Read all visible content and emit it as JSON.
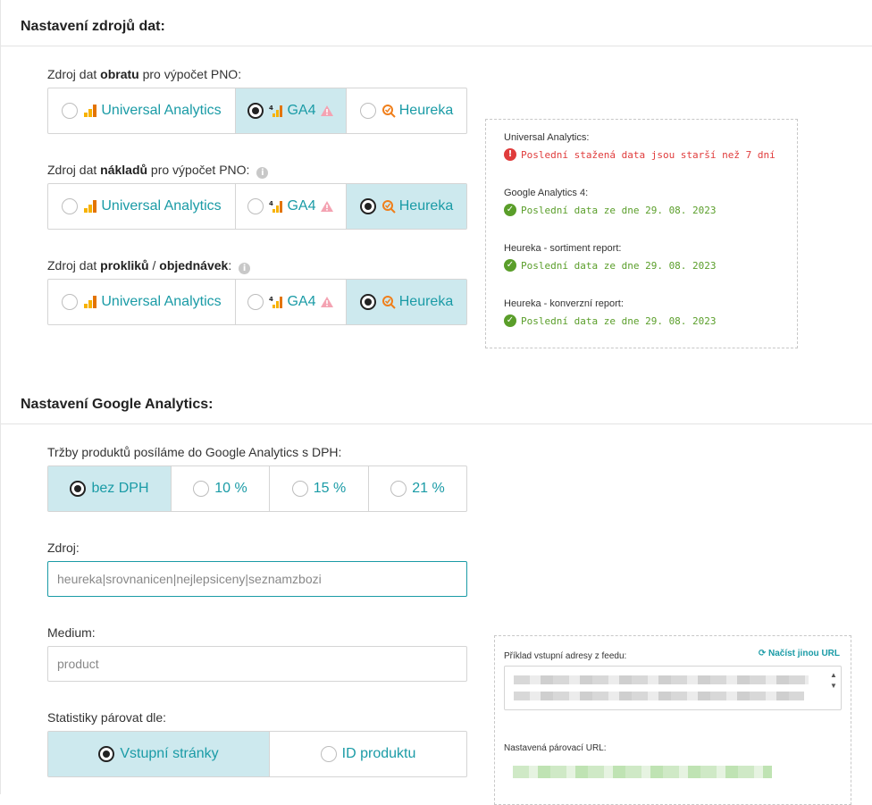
{
  "sources": {
    "title": "Nastavení zdrojů dat:",
    "revenue_label": {
      "pre": "Zdroj dat ",
      "bold": "obratu",
      "post": " pro výpočet PNO:"
    },
    "cost_label": {
      "pre": "Zdroj dat ",
      "bold": "nákladů",
      "post": " pro výpočet PNO:"
    },
    "clicks_label": {
      "pre": "Zdroj dat ",
      "bold1": "prokliků",
      "mid": " / ",
      "bold2": "objednávek",
      "post": ":"
    },
    "options": {
      "ua": "Universal Analytics",
      "ga4": "GA4",
      "heureka": "Heureka"
    },
    "selected": {
      "revenue": "GA4",
      "cost": "Heureka",
      "clicks": "Heureka"
    }
  },
  "status": {
    "items": [
      {
        "title": "Universal Analytics:",
        "message": "Poslední stažená data jsou starší než 7 dní",
        "state": "error"
      },
      {
        "title": "Google Analytics 4:",
        "message": "Poslední data ze dne 29. 08. 2023",
        "state": "ok"
      },
      {
        "title": "Heureka - sortiment report:",
        "message": "Poslední data ze dne 29. 08. 2023",
        "state": "ok"
      },
      {
        "title": "Heureka - konverzní report:",
        "message": "Poslední data ze dne 29. 08. 2023",
        "state": "ok"
      }
    ]
  },
  "ga": {
    "title": "Nastavení Google Analytics:",
    "vat_label": "Tržby produktů posíláme do Google Analytics s DPH:",
    "vat_options": [
      "bez DPH",
      "10 %",
      "15 %",
      "21 %"
    ],
    "vat_selected": "bez DPH",
    "source_label": "Zdroj:",
    "source_value": "heureka|srovnanicen|nejlepsiceny|seznamzbozi",
    "medium_label": "Medium:",
    "medium_value": "product",
    "pair_label": "Statistiky párovat dle:",
    "pair_options": [
      "Vstupní stránky",
      "ID produktu"
    ],
    "pair_selected": "Vstupní stránky"
  },
  "feed": {
    "example_label": "Příklad vstupní adresy z feedu:",
    "reload_label": "Načíst jinou URL",
    "pairing_label": "Nastavená párovací URL:"
  },
  "colors": {
    "accent": "#1a9ba6",
    "active_bg": "#cde9ee",
    "error": "#e03c3c",
    "ok": "#5a9e2a"
  }
}
